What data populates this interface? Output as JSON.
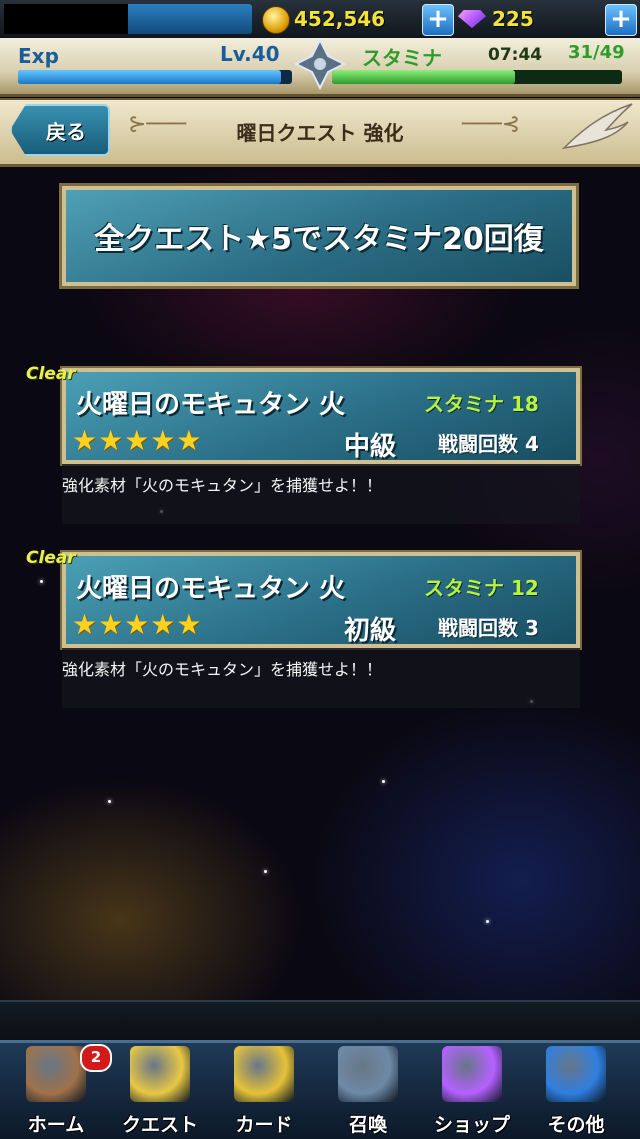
{
  "top_bar": {
    "coins": "452,546",
    "gems": "225",
    "plus_symbol": "+"
  },
  "status": {
    "exp_label": "Exp",
    "level": "Lv.40",
    "exp_fraction": 0.96,
    "stamina_label": "スタミナ",
    "stamina_timer": "07:44",
    "stamina_count": "31/49",
    "stamina_fraction": 0.63
  },
  "header": {
    "back_label": "戻る",
    "title": "曜日クエスト 強化"
  },
  "banner": {
    "text": "全クエスト★5でスタミナ20回復"
  },
  "quests": [
    {
      "clear": "Clear",
      "title": "火曜日のモキュタン 火",
      "stamina": "スタミナ 18",
      "stars": "★★★★★",
      "difficulty": "中級",
      "battles": "戦闘回数 4",
      "description": "強化素材「火のモキュタン」を捕獲せよ！！"
    },
    {
      "clear": "Clear",
      "title": "火曜日のモキュタン 火",
      "stamina": "スタミナ 12",
      "stars": "★★★★★",
      "difficulty": "初級",
      "battles": "戦闘回数 3",
      "description": "強化素材「火のモキュタン」を捕獲せよ！！"
    }
  ],
  "tabs": [
    {
      "label": "ホーム",
      "badge": "2",
      "icon": "home-icon",
      "color": "#a0724a"
    },
    {
      "label": "クエスト",
      "icon": "quest-icon",
      "color": "#e8c845"
    },
    {
      "label": "カード",
      "icon": "card-icon",
      "color": "#e6c23a"
    },
    {
      "label": "召喚",
      "icon": "summon-icon",
      "color": "#6e8aa6"
    },
    {
      "label": "ショップ",
      "icon": "shop-gem-icon",
      "color": "#b561ff"
    },
    {
      "label": "その他",
      "icon": "other-icon",
      "color": "#2f7fe0"
    }
  ],
  "colors": {
    "accent_blue": "#1a5e97",
    "stamina_green": "#2f9c2a",
    "coin_yellow": "#f4e23c",
    "card_teal": "#2a6e86"
  }
}
